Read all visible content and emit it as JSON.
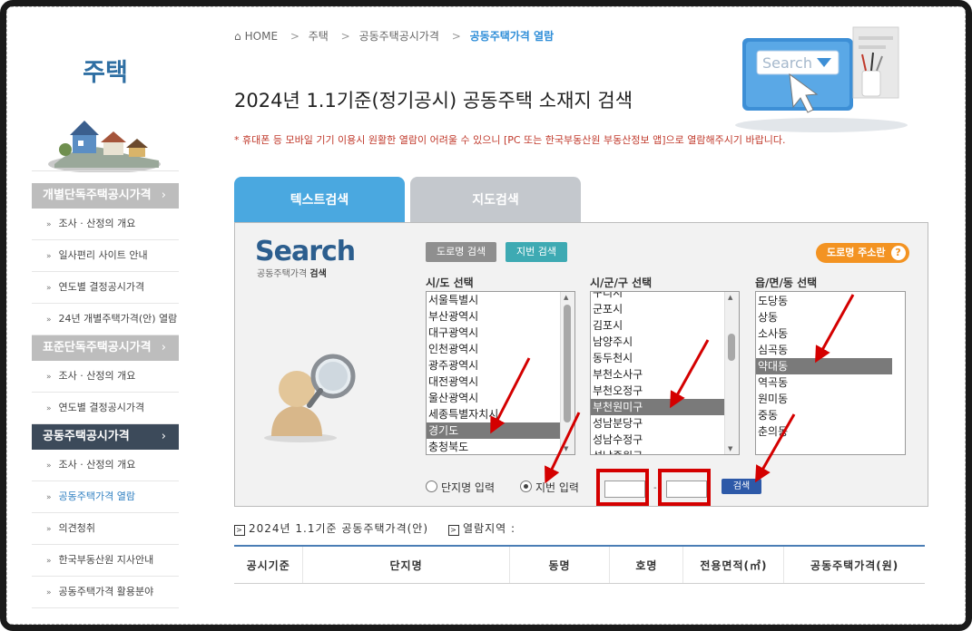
{
  "sidebar": {
    "title": "주택",
    "menu": [
      {
        "type": "cat",
        "label": "개별단독주택공시가격",
        "arrow": "›",
        "active": false
      },
      {
        "type": "item",
        "label": "조사 · 산정의 개요"
      },
      {
        "type": "item",
        "label": "일사편리 사이트 안내"
      },
      {
        "type": "item",
        "label": "연도별 결정공시가격"
      },
      {
        "type": "item",
        "label": "24년 개별주택가격(안) 열람"
      },
      {
        "type": "cat",
        "label": "표준단독주택공시가격",
        "arrow": "›",
        "active": false
      },
      {
        "type": "item",
        "label": "조사 · 산정의 개요"
      },
      {
        "type": "item",
        "label": "연도별 결정공시가격"
      },
      {
        "type": "cat",
        "label": "공동주택공시가격",
        "arrow": "›",
        "active": true
      },
      {
        "type": "item",
        "label": "조사 · 산정의 개요"
      },
      {
        "type": "item",
        "label": "공동주택가격 열람",
        "current": true
      },
      {
        "type": "item",
        "label": "의견청취"
      },
      {
        "type": "item",
        "label": "한국부동산원 지사안내"
      },
      {
        "type": "item",
        "label": "공동주택가격 활용분야"
      }
    ],
    "bullet": "»"
  },
  "breadcrumb": {
    "home": "HOME",
    "items": [
      "주택",
      "공동주택공시가격",
      "공동주택가격 열람"
    ],
    "sep": ">"
  },
  "hero_search_text": "Search",
  "page_title": "2024년 1.1기준(정기공시) 공동주택 소재지 검색",
  "notice": "* 휴대폰 등 모바일 기기 이용시 원활한 열람이 어려울 수 있으니 [PC 또는 한국부동산원 부동산정보 앱]으로 열람해주시기 바랍니다.",
  "tabs": {
    "text": "텍스트검색",
    "map": "지도검색"
  },
  "search": {
    "logo": "Search",
    "sub_prefix": "공동주택가격 ",
    "sub_bold": "검색",
    "road_button": "도로명 검색",
    "lot_button": "지번 검색",
    "road_info": "도로명 주소란",
    "road_info_q": "?",
    "sido_label": "시/도 선택",
    "sigungu_label": "시/군/구 선택",
    "dong_label": "읍/면/동 선택",
    "sido_options": [
      "서울특별시",
      "부산광역시",
      "대구광역시",
      "인천광역시",
      "광주광역시",
      "대전광역시",
      "울산광역시",
      "세종특별자치시",
      "경기도",
      "충청북도"
    ],
    "sido_selected": 8,
    "sigungu_options": [
      "구리시",
      "군포시",
      "김포시",
      "남양주시",
      "동두천시",
      "부천소사구",
      "부천오정구",
      "부천원미구",
      "성남분당구",
      "성남수정구",
      "성남중원구"
    ],
    "sigungu_selected": 7,
    "dong_options": [
      "도당동",
      "상동",
      "소사동",
      "심곡동",
      "약대동",
      "역곡동",
      "원미동",
      "중동",
      "춘의동"
    ],
    "dong_selected": 4,
    "radio_complex": "단지명 입력",
    "radio_lot": "지번 입력",
    "lot_dash": "-",
    "go_button": "검색"
  },
  "result": {
    "basis": "2024년 1.1기준 공동주택가격(안)",
    "area": "열람지역 :",
    "icon": ">",
    "columns": [
      "공시기준",
      "단지명",
      "동명",
      "호명",
      "전용면적(㎡)",
      "공동주택가격(원)"
    ]
  },
  "colors": {
    "accent": "#4aa8e0",
    "arrow": "#d40000",
    "nav_dark": "#3c4a5a"
  }
}
